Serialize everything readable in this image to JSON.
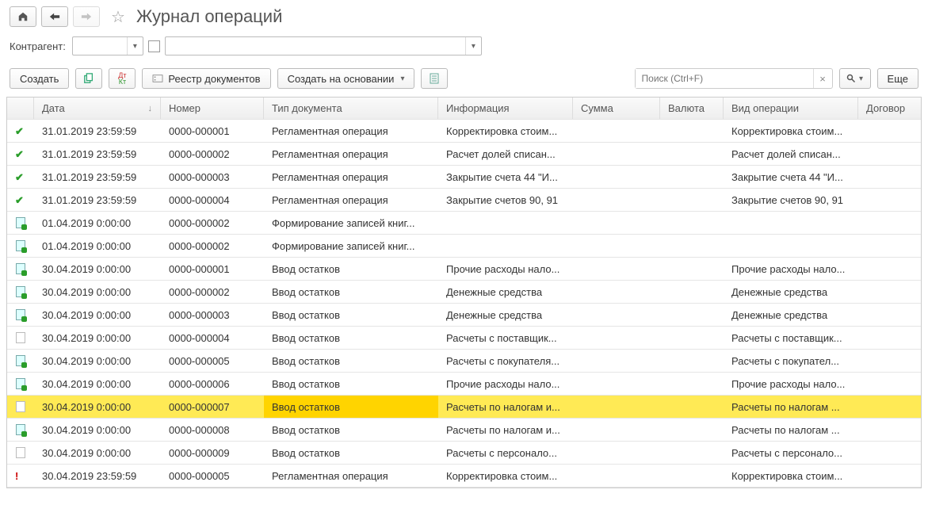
{
  "header": {
    "title": "Журнал операций"
  },
  "filter": {
    "label": "Контрагент:"
  },
  "toolbar": {
    "create": "Создать",
    "registry": "Реестр документов",
    "create_based": "Создать на основании",
    "more": "Еще",
    "search_placeholder": "Поиск (Ctrl+F)"
  },
  "columns": {
    "date": "Дата",
    "number": "Номер",
    "doctype": "Тип документа",
    "info": "Информация",
    "sum": "Сумма",
    "currency": "Валюта",
    "optype": "Вид операции",
    "contract": "Договор"
  },
  "rows": [
    {
      "icon": "check",
      "date": "31.01.2019 23:59:59",
      "num": "0000-000001",
      "type": "Регламентная операция",
      "info": "Корректировка стоим...",
      "sum": "",
      "cur": "",
      "op": "Корректировка стоим..."
    },
    {
      "icon": "check",
      "date": "31.01.2019 23:59:59",
      "num": "0000-000002",
      "type": "Регламентная операция",
      "info": "Расчет долей списан...",
      "sum": "",
      "cur": "",
      "op": "Расчет долей списан..."
    },
    {
      "icon": "check",
      "date": "31.01.2019 23:59:59",
      "num": "0000-000003",
      "type": "Регламентная операция",
      "info": "Закрытие счета 44 \"И...",
      "sum": "",
      "cur": "",
      "op": "Закрытие счета 44 \"И..."
    },
    {
      "icon": "check",
      "date": "31.01.2019 23:59:59",
      "num": "0000-000004",
      "type": "Регламентная операция",
      "info": "Закрытие счетов 90, 91",
      "sum": "",
      "cur": "",
      "op": "Закрытие счетов 90, 91"
    },
    {
      "icon": "docg",
      "date": "01.04.2019 0:00:00",
      "num": "0000-000002",
      "type": "Формирование записей книг...",
      "info": "",
      "sum": "",
      "cur": "",
      "op": ""
    },
    {
      "icon": "docg",
      "date": "01.04.2019 0:00:00",
      "num": "0000-000002",
      "type": "Формирование записей книг...",
      "info": "",
      "sum": "",
      "cur": "",
      "op": ""
    },
    {
      "icon": "docg",
      "date": "30.04.2019 0:00:00",
      "num": "0000-000001",
      "type": "Ввод остатков",
      "info": "Прочие расходы нало...",
      "sum": "",
      "cur": "",
      "op": "Прочие расходы нало..."
    },
    {
      "icon": "docg",
      "date": "30.04.2019 0:00:00",
      "num": "0000-000002",
      "type": "Ввод остатков",
      "info": "Денежные средства",
      "sum": "",
      "cur": "",
      "op": "Денежные средства"
    },
    {
      "icon": "docg",
      "date": "30.04.2019 0:00:00",
      "num": "0000-000003",
      "type": "Ввод остатков",
      "info": "Денежные средства",
      "sum": "",
      "cur": "",
      "op": "Денежные средства"
    },
    {
      "icon": "doc",
      "date": "30.04.2019 0:00:00",
      "num": "0000-000004",
      "type": "Ввод остатков",
      "info": "Расчеты с поставщик...",
      "sum": "",
      "cur": "",
      "op": "Расчеты с поставщик..."
    },
    {
      "icon": "docg",
      "date": "30.04.2019 0:00:00",
      "num": "0000-000005",
      "type": "Ввод остатков",
      "info": "Расчеты с покупателя...",
      "sum": "",
      "cur": "",
      "op": "Расчеты с покупател..."
    },
    {
      "icon": "docg",
      "date": "30.04.2019 0:00:00",
      "num": "0000-000006",
      "type": "Ввод остатков",
      "info": "Прочие расходы нало...",
      "sum": "",
      "cur": "",
      "op": "Прочие расходы нало..."
    },
    {
      "icon": "doc",
      "date": "30.04.2019 0:00:00",
      "num": "0000-000007",
      "type": "Ввод остатков",
      "info": "Расчеты по налогам и...",
      "sum": "",
      "cur": "",
      "op": "Расчеты по налогам ...",
      "selected": true
    },
    {
      "icon": "docg",
      "date": "30.04.2019 0:00:00",
      "num": "0000-000008",
      "type": "Ввод остатков",
      "info": "Расчеты по налогам и...",
      "sum": "",
      "cur": "",
      "op": "Расчеты по налогам ..."
    },
    {
      "icon": "doc",
      "date": "30.04.2019 0:00:00",
      "num": "0000-000009",
      "type": "Ввод остатков",
      "info": "Расчеты с персонало...",
      "sum": "",
      "cur": "",
      "op": "Расчеты с персонало..."
    },
    {
      "icon": "alert",
      "date": "30.04.2019 23:59:59",
      "num": "0000-000005",
      "type": "Регламентная операция",
      "info": "Корректировка стоим...",
      "sum": "",
      "cur": "",
      "op": "Корректировка стоим..."
    }
  ]
}
